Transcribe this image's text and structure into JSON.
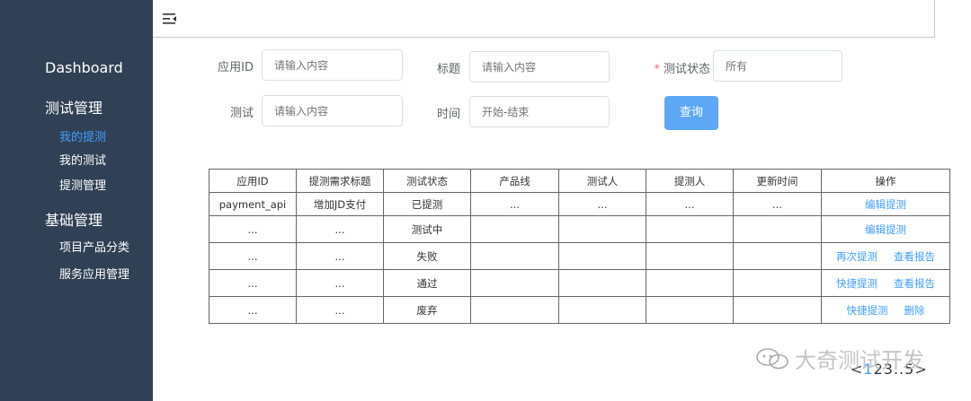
{
  "sidebar": {
    "dashboard": "Dashboard",
    "groups": [
      {
        "label": "测试管理",
        "items": [
          {
            "label": "我的提测",
            "active": true
          },
          {
            "label": "我的测试",
            "active": false
          },
          {
            "label": "提测管理",
            "active": false
          }
        ]
      },
      {
        "label": "基础管理",
        "items": [
          {
            "label": "项目产品分类",
            "active": false
          },
          {
            "label": "服务应用管理",
            "active": false
          }
        ]
      }
    ]
  },
  "form": {
    "app_id_label": "应用ID",
    "app_id_placeholder": "请输入内容",
    "title_label": "标题",
    "title_placeholder": "请输入内容",
    "status_label": "测试状态",
    "status_required_mark": "*",
    "status_placeholder": "所有",
    "test_label": "测试",
    "test_placeholder": "请输入内容",
    "time_label": "时间",
    "time_placeholder": "开始-结束",
    "query_button": "查询"
  },
  "table": {
    "headers": [
      "应用ID",
      "提测需求标题",
      "测试状态",
      "产品线",
      "测试人",
      "提测人",
      "更新时间",
      "操作"
    ],
    "rows": [
      {
        "cells": [
          "payment_api",
          "增加JD支付",
          "已提测",
          "...",
          "...",
          "...",
          "..."
        ],
        "ops": [
          "编辑提测"
        ]
      },
      {
        "cells": [
          "...",
          "...",
          "测试中",
          "",
          "",
          "",
          ""
        ],
        "ops": [
          "编辑提测"
        ]
      },
      {
        "cells": [
          "...",
          "...",
          "失败",
          "",
          "",
          "",
          ""
        ],
        "ops": [
          "再次提测",
          "查看报告"
        ]
      },
      {
        "cells": [
          "...",
          "...",
          "通过",
          "",
          "",
          "",
          ""
        ],
        "ops": [
          "快捷提测",
          "查看报告"
        ]
      },
      {
        "cells": [
          "...",
          "...",
          "废弃",
          "",
          "",
          "",
          ""
        ],
        "ops": [
          "快捷提测",
          "删除"
        ]
      }
    ]
  },
  "pagination": {
    "prev": "<",
    "pages": [
      "1",
      "2",
      "3",
      "..",
      "5"
    ],
    "current": "1",
    "next": ">"
  },
  "watermark": "大奇测试开发",
  "colors": {
    "sidebar_bg": "#304156",
    "accent": "#409eff",
    "button_bg": "#5ca8f5",
    "required": "#f56c6c"
  }
}
